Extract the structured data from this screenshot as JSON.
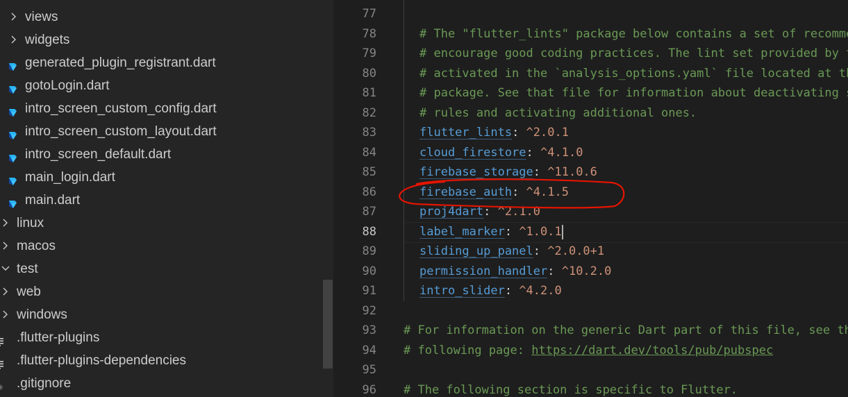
{
  "explorer": {
    "items": [
      {
        "label": "views",
        "kind": "folder",
        "expanded": false,
        "indent": 1
      },
      {
        "label": "widgets",
        "kind": "folder",
        "expanded": false,
        "indent": 1
      },
      {
        "label": "generated_plugin_registrant.dart",
        "kind": "dart",
        "indent": 1
      },
      {
        "label": "gotoLogin.dart",
        "kind": "dart",
        "indent": 1
      },
      {
        "label": "intro_screen_custom_config.dart",
        "kind": "dart",
        "indent": 1
      },
      {
        "label": "intro_screen_custom_layout.dart",
        "kind": "dart",
        "indent": 1
      },
      {
        "label": "intro_screen_default.dart",
        "kind": "dart",
        "indent": 1
      },
      {
        "label": "main_login.dart",
        "kind": "dart",
        "indent": 1
      },
      {
        "label": "main.dart",
        "kind": "dart",
        "indent": 1
      },
      {
        "label": "linux",
        "kind": "folder",
        "expanded": false,
        "indent": 0
      },
      {
        "label": "macos",
        "kind": "folder",
        "expanded": false,
        "indent": 0
      },
      {
        "label": "test",
        "kind": "folder",
        "expanded": true,
        "indent": 0
      },
      {
        "label": "web",
        "kind": "folder",
        "expanded": false,
        "indent": 0
      },
      {
        "label": "windows",
        "kind": "folder",
        "expanded": false,
        "indent": 0
      },
      {
        "label": ".flutter-plugins",
        "kind": "text",
        "indent": 0
      },
      {
        "label": ".flutter-plugins-dependencies",
        "kind": "text",
        "indent": 0
      },
      {
        "label": ".gitignore",
        "kind": "git",
        "indent": 0
      }
    ]
  },
  "editor": {
    "active_line": 88,
    "lines": [
      {
        "num": "77",
        "type": "blank"
      },
      {
        "num": "78",
        "type": "comment",
        "indent": true,
        "text": "# The \"flutter_lints\" package below contains a set of recommended lints to"
      },
      {
        "num": "79",
        "type": "comment",
        "indent": true,
        "text": "# encourage good coding practices. The lint set provided by the package is"
      },
      {
        "num": "80",
        "type": "comment",
        "indent": true,
        "text": "# activated in the `analysis_options.yaml` file located at the root of your"
      },
      {
        "num": "81",
        "type": "comment",
        "indent": true,
        "text": "# package. See that file for information about deactivating specific lint"
      },
      {
        "num": "82",
        "type": "comment",
        "indent": true,
        "text": "# rules and activating additional ones."
      },
      {
        "num": "83",
        "type": "dep",
        "key": "flutter_lints",
        "value": "^2.0.1"
      },
      {
        "num": "84",
        "type": "dep",
        "key": "cloud_firestore",
        "value": "^4.1.0"
      },
      {
        "num": "85",
        "type": "dep",
        "key": "firebase_storage",
        "value": "^11.0.6"
      },
      {
        "num": "86",
        "type": "dep",
        "key": "firebase_auth",
        "value": "^4.1.5"
      },
      {
        "num": "87",
        "type": "dep",
        "key": "proj4dart",
        "value": "^2.1.0"
      },
      {
        "num": "88",
        "type": "dep",
        "key": "label_marker",
        "value": "^1.0.1"
      },
      {
        "num": "89",
        "type": "dep",
        "key": "sliding_up_panel",
        "value": "^2.0.0+1"
      },
      {
        "num": "90",
        "type": "dep",
        "key": "permission_handler",
        "value": "^10.2.0"
      },
      {
        "num": "91",
        "type": "dep",
        "key": "intro_slider",
        "value": "^4.2.0"
      },
      {
        "num": "92",
        "type": "blank"
      },
      {
        "num": "93",
        "type": "comment",
        "indent": false,
        "text": "# For information on the generic Dart part of this file, see the"
      },
      {
        "num": "94",
        "type": "link",
        "prefix": "# following page: ",
        "link": "https://dart.dev/tools/pub/pubspec"
      },
      {
        "num": "95",
        "type": "blank"
      },
      {
        "num": "96",
        "type": "comment",
        "indent": false,
        "text": "# The following section is specific to Flutter."
      }
    ]
  },
  "colors": {
    "comment": "#6a9955",
    "key": "#569cd6",
    "value": "#ce9178",
    "annotation": "#e51400",
    "dart_icon": "#42a5f5"
  },
  "icons": {
    "folder_collapsed": "chevron-right-icon",
    "folder_expanded": "chevron-down-icon",
    "dart": "dart-file-icon",
    "text": "text-file-icon",
    "git": "git-file-icon"
  },
  "annotation": {
    "type": "red-freehand-ellipse",
    "target_line": "86"
  }
}
